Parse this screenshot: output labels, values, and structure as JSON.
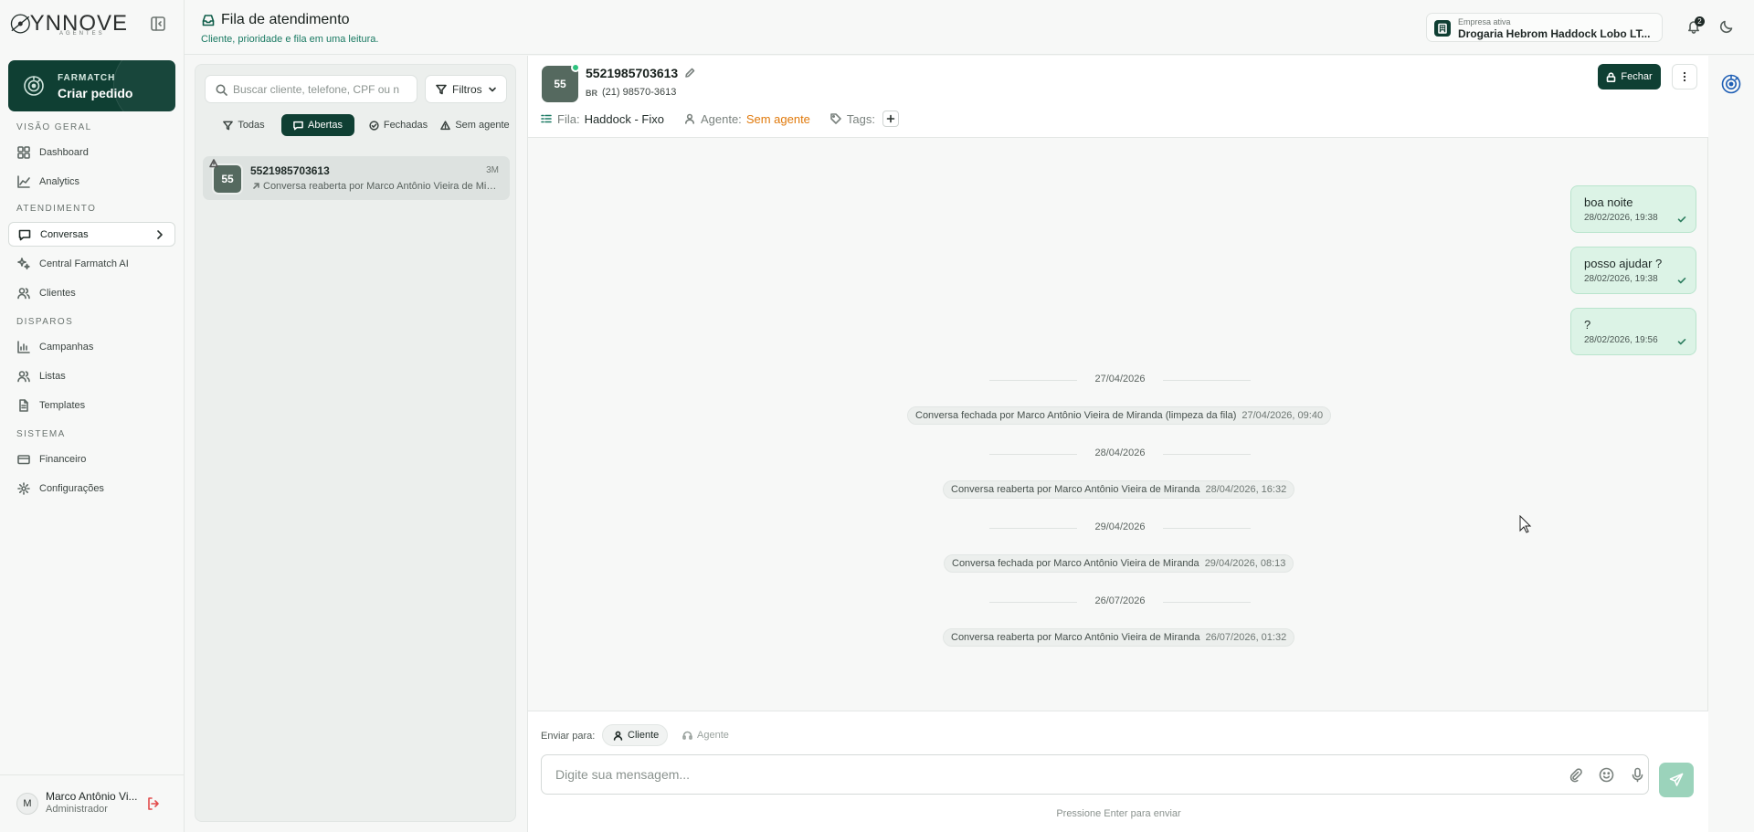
{
  "brand": {
    "logo_text": "YNNOVE",
    "logo_sub": "AGENTES"
  },
  "cta": {
    "line1": "FARMATCH",
    "line2": "Criar pedido"
  },
  "nav": {
    "sections": {
      "overview": "VISÃO GERAL",
      "service": "ATENDIMENTO",
      "dispatch": "DISPAROS",
      "system": "SISTEMA"
    },
    "items": {
      "dashboard": "Dashboard",
      "analytics": "Analytics",
      "conversas": "Conversas",
      "central": "Central Farmatch AI",
      "clientes": "Clientes",
      "campanhas": "Campanhas",
      "listas": "Listas",
      "templates": "Templates",
      "financeiro": "Financeiro",
      "configuracoes": "Configurações"
    },
    "active": "conversas"
  },
  "user": {
    "initial": "M",
    "name": "Marco Antônio Vi...",
    "role": "Administrador"
  },
  "header": {
    "title": "Fila de atendimento",
    "subtitle": "Cliente, prioridade e fila em uma leitura.",
    "company_label": "Empresa ativa",
    "company_name": "Drogaria Hebrom Haddock Lobo LT...",
    "notifications": "2"
  },
  "list": {
    "search_placeholder": "Buscar cliente, telefone, CPF ou n",
    "filters_label": "Filtros",
    "tabs": {
      "all": "Todas",
      "open": "Abertas",
      "closed": "Fechadas",
      "no_agent": "Sem agente"
    },
    "active_tab": "open",
    "conversations": [
      {
        "avatar": "55",
        "name": "5521985703613",
        "time": "3M",
        "preview": "Conversa reaberta por Marco Antônio Vieira de Miranda"
      }
    ]
  },
  "chat": {
    "avatar": "55",
    "name": "5521985703613",
    "country": "BR",
    "phone": "(21) 98570-3613",
    "queue_label": "Fila:",
    "queue_value": "Haddock - Fixo",
    "agent_label": "Agente:",
    "agent_value": "Sem agente",
    "tags_label": "Tags:",
    "close_label": "Fechar",
    "messages": [
      {
        "text": "boa noite",
        "meta": "28/02/2026, 19:38"
      },
      {
        "text": "posso ajudar ?",
        "meta": "28/02/2026, 19:38"
      },
      {
        "text": "?",
        "meta": "28/02/2026, 19:56"
      }
    ],
    "events": [
      {
        "date": "27/04/2026",
        "text": "Conversa fechada por Marco Antônio Vieira de Miranda (limpeza da fila)",
        "time": "27/04/2026, 09:40"
      },
      {
        "date": "28/04/2026",
        "text": "Conversa reaberta por Marco Antônio Vieira de Miranda",
        "time": "28/04/2026, 16:32"
      },
      {
        "date": "29/04/2026",
        "text": "Conversa fechada por Marco Antônio Vieira de Miranda",
        "time": "29/04/2026, 08:13"
      },
      {
        "date": "26/07/2026",
        "text": "Conversa reaberta por Marco Antônio Vieira de Miranda",
        "time": "26/07/2026, 01:32"
      }
    ]
  },
  "composer": {
    "send_to_label": "Enviar para:",
    "client_label": "Cliente",
    "agent_label": "Agente",
    "placeholder": "Digite sua mensagem...",
    "hint": "Pressione Enter para enviar"
  },
  "colors": {
    "brand_dark": "#0f3f33",
    "accent_green": "#1a7a63",
    "outgoing_bubble": "#dcf3e6",
    "warning_orange": "#e0790b",
    "online_dot": "#2ec27e"
  }
}
